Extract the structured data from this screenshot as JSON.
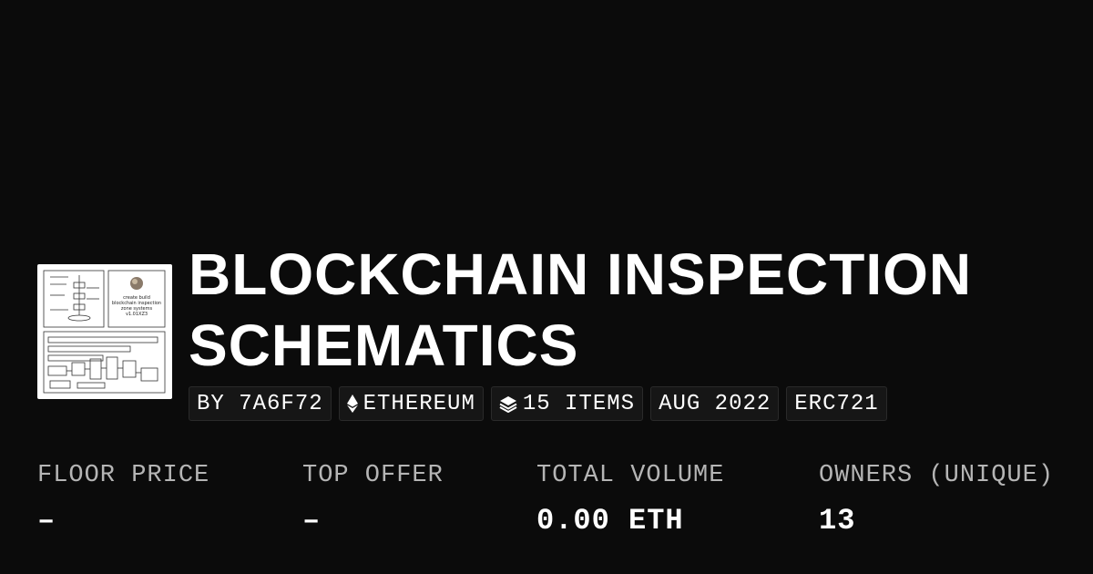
{
  "collection": {
    "title_line1": "BLOCKCHAIN INSPECTION",
    "title_line2": "SCHEMATICS",
    "thumbnail_text": [
      "create build",
      "blockchain inspection",
      "zone systems",
      "v1.01XZ3"
    ],
    "thumbnail_icon": "schematic-drawing"
  },
  "tags": {
    "creator": "BY 7A6F72",
    "chain": "ETHEREUM",
    "chain_icon": "ethereum-icon",
    "items": "15 ITEMS",
    "items_icon": "layers-icon",
    "date": "AUG 2022",
    "standard": "ERC721"
  },
  "stats": {
    "floor_price_label": "FLOOR PRICE",
    "floor_price_value": "–",
    "top_offer_label": "TOP OFFER",
    "top_offer_value": "–",
    "total_volume_label": "TOTAL VOLUME",
    "total_volume_value": "0.00 ETH",
    "owners_label": "OWNERS (UNIQUE)",
    "owners_value": "13"
  },
  "colors": {
    "background": "#0b0b0b",
    "tag_background": "#161616",
    "label_gray": "#b5b5b5",
    "text": "#ffffff"
  }
}
